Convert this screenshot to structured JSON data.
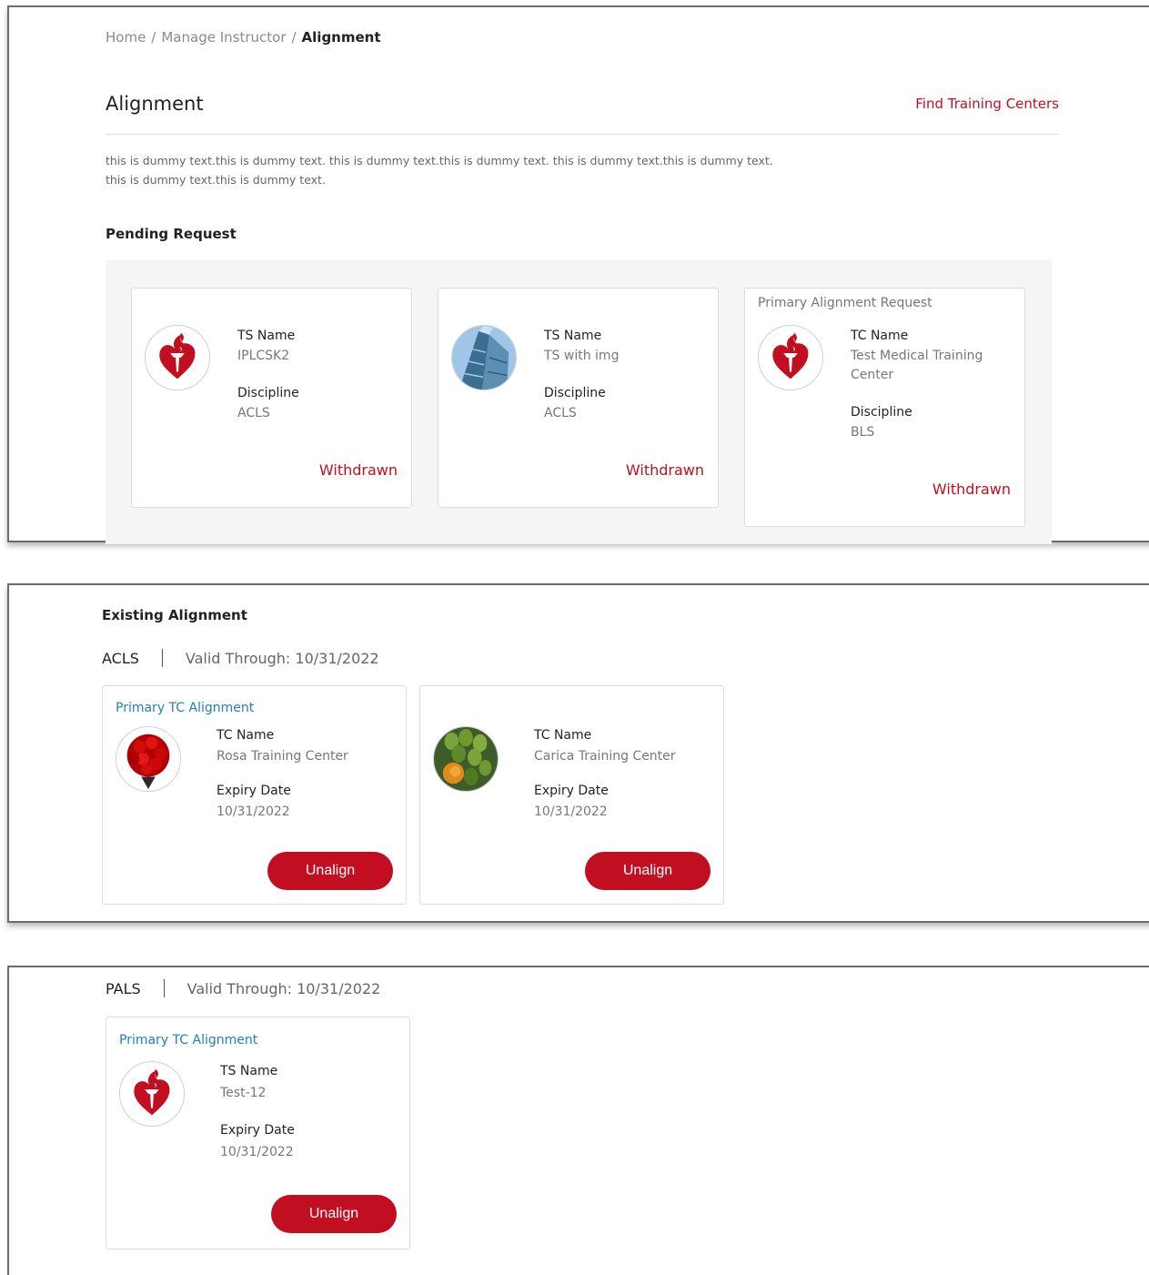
{
  "breadcrumb": {
    "home": "Home",
    "manage": "Manage Instructor",
    "current": "Alignment"
  },
  "page": {
    "title": "Alignment",
    "find_link": "Find Training Centers",
    "description_line1": "this is dummy text.this is dummy text. this is dummy text.this is dummy text. this is dummy text.this is dummy text.",
    "description_line2": "this is dummy text.this is dummy text."
  },
  "pending": {
    "title": "Pending Request",
    "cards": [
      {
        "header": "",
        "name_label": "TS Name",
        "name_value": "IPLCSK2",
        "discipline_label": "Discipline",
        "discipline_value": "ACLS",
        "action": "Withdrawn",
        "avatar": "aha-heart-logo"
      },
      {
        "header": "",
        "name_label": "TS Name",
        "name_value": "TS with img",
        "discipline_label": "Discipline",
        "discipline_value": "ACLS",
        "action": "Withdrawn",
        "avatar": "building-photo"
      },
      {
        "header": "Primary Alignment Request",
        "name_label": "TC Name",
        "name_value": "Test Medical Training Center",
        "discipline_label": "Discipline",
        "discipline_value": "BLS",
        "action": "Withdrawn",
        "avatar": "aha-heart-logo"
      }
    ]
  },
  "existing": {
    "title": "Existing Alignment",
    "groups": [
      {
        "discipline": "ACLS",
        "valid_through": "Valid Through: 10/31/2022",
        "cards": [
          {
            "header": "Primary TC Alignment",
            "name_label": "TC Name",
            "name_value": "Rosa Training Center",
            "expiry_label": "Expiry Date",
            "expiry_value": "10/31/2022",
            "action": "Unalign",
            "avatar": "roses-photo"
          },
          {
            "header": "",
            "name_label": "TC Name",
            "name_value": "Carica Training Center",
            "expiry_label": "Expiry Date",
            "expiry_value": "10/31/2022",
            "action": "Unalign",
            "avatar": "papaya-photo"
          }
        ]
      },
      {
        "discipline": "PALS",
        "valid_through": "Valid Through: 10/31/2022",
        "cards": [
          {
            "header": "Primary TC Alignment",
            "name_label": "TS Name",
            "name_value": "Test-12",
            "expiry_label": "Expiry Date",
            "expiry_value": "10/31/2022",
            "action": "Unalign",
            "avatar": "aha-heart-logo"
          }
        ]
      }
    ]
  },
  "colors": {
    "brand_red": "#c10e21",
    "link_blue": "#1f7fbf",
    "panel_gray": "#f5f5f5"
  }
}
